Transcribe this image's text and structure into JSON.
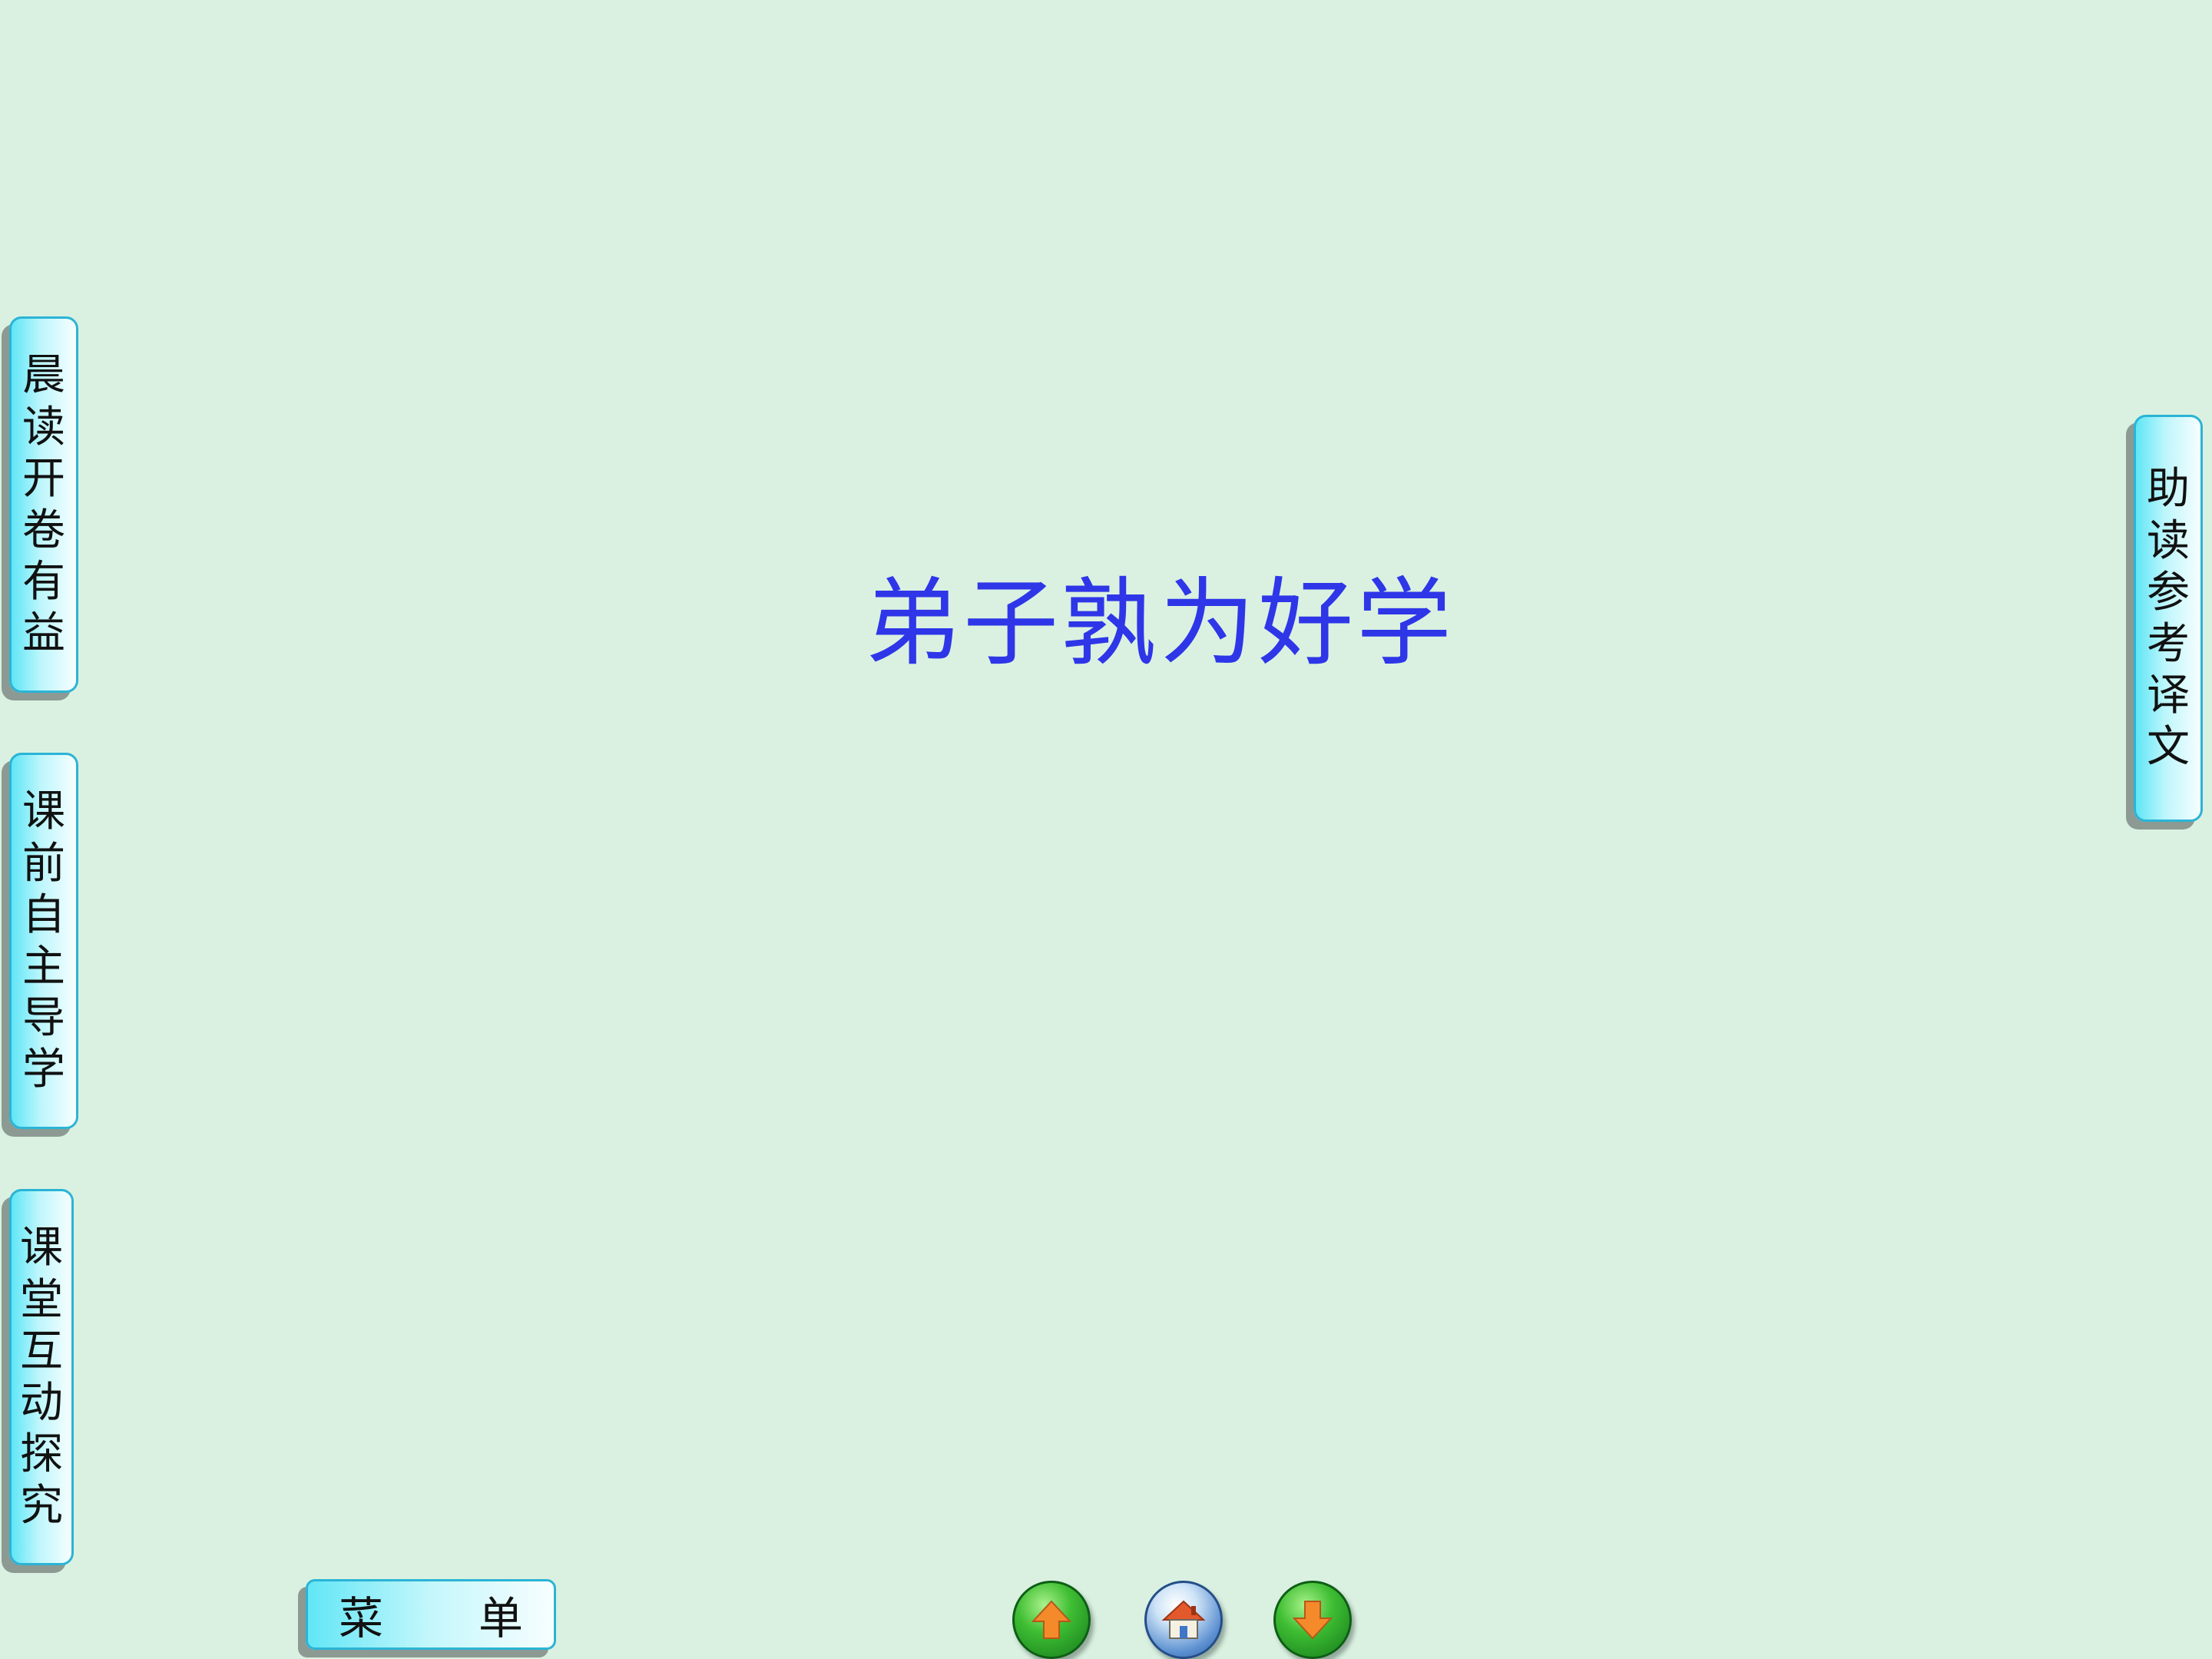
{
  "left_tabs": [
    {
      "label": "晨读开卷有益"
    },
    {
      "label": "课前自主导学"
    },
    {
      "label": "课堂互动探究"
    }
  ],
  "right_tab": {
    "label": "助读参考译文"
  },
  "title": "弟子孰为好学",
  "menu": {
    "char1": "菜",
    "char2": "单"
  },
  "nav": {
    "prev_icon": "up-arrow-icon",
    "home_icon": "home-icon",
    "next_icon": "down-arrow-icon"
  },
  "colors": {
    "background": "#DAF1E1",
    "title": "#2E36E8",
    "tab_border": "#2BB4D6",
    "nav_arrow": "#F48A2A"
  }
}
